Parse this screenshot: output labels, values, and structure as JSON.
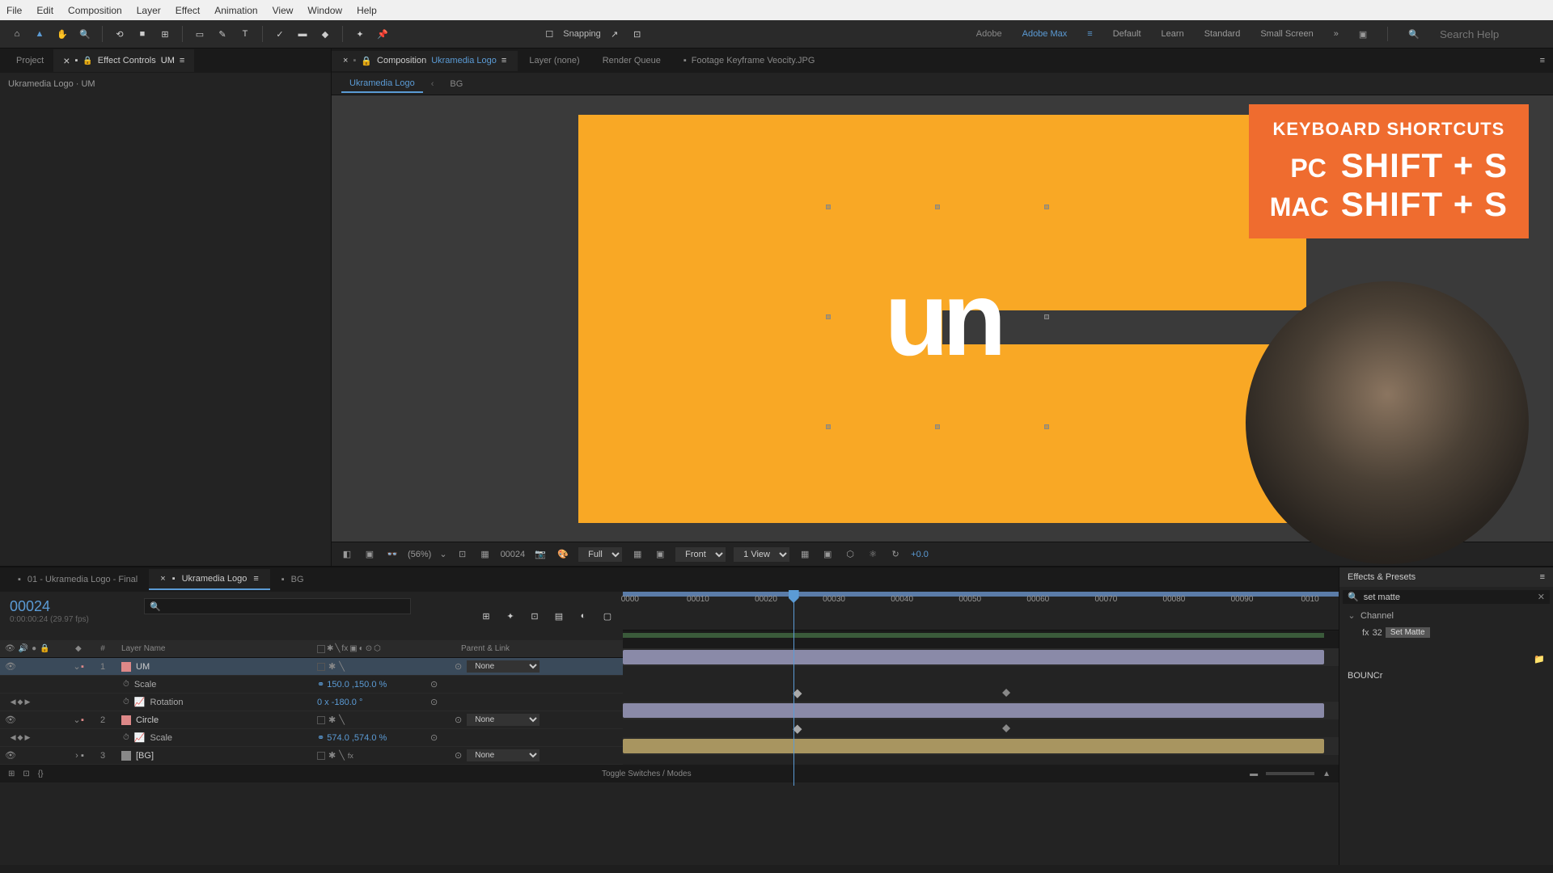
{
  "menubar": [
    "File",
    "Edit",
    "Composition",
    "Layer",
    "Effect",
    "Animation",
    "View",
    "Window",
    "Help"
  ],
  "toolbar": {
    "snapping": "Snapping",
    "right": {
      "adobe": "Adobe",
      "adobemax": "Adobe Max",
      "default": "Default",
      "learn": "Learn",
      "standard": "Standard",
      "smallscreen": "Small Screen",
      "search_placeholder": "Search Help"
    }
  },
  "project": {
    "tab": "Project",
    "ectab": "Effect Controls",
    "eclayer": "UM",
    "path": "Ukramedia Logo · UM"
  },
  "comp": {
    "tab": "Composition",
    "active": "Ukramedia Logo",
    "layer_tab": "Layer  (none)",
    "render_tab": "Render Queue",
    "footage_tab": "Footage  Keyframe Veocity.JPG",
    "nav1": "Ukramedia Logo",
    "nav2": "BG"
  },
  "viewer": {
    "zoom": "(56%)",
    "frame": "00024",
    "res": "Full",
    "mode": "Front",
    "views": "1 View",
    "exposure": "+0.0"
  },
  "overlay": {
    "title": "KEYBOARD SHORTCUTS",
    "pc": "PC",
    "pc_keys": "SHIFT + S",
    "mac": "MAC",
    "mac_keys": "SHIFT + S"
  },
  "timeline": {
    "tab1": "01 - Ukramedia Logo - Final",
    "tab2": "Ukramedia Logo",
    "tab3": "BG",
    "frame": "00024",
    "timecode": "0:00:00:24 (29.97 fps)",
    "ticks": [
      "0000",
      "00010",
      "00020",
      "00030",
      "00040",
      "00050",
      "00060",
      "00070",
      "00080",
      "00090",
      "0010"
    ],
    "col_name": "Layer Name",
    "col_parent": "Parent & Link",
    "layers": [
      {
        "num": "1",
        "name": "UM",
        "parent": "None",
        "props": [
          {
            "name": "Scale",
            "value": "150.0 ,150.0 %"
          },
          {
            "name": "Rotation",
            "value": "0 x -180.0 °"
          }
        ]
      },
      {
        "num": "2",
        "name": "Circle",
        "parent": "None",
        "props": [
          {
            "name": "Scale",
            "value": "574.0 ,574.0 %"
          }
        ]
      },
      {
        "num": "3",
        "name": "[BG]",
        "parent": "None",
        "props": []
      }
    ],
    "toggle": "Toggle Switches / Modes"
  },
  "effects": {
    "title": "Effects & Presets",
    "search": "set matte",
    "cat": "Channel",
    "item": "Set Matte",
    "bouncr": "BOUNCr"
  }
}
